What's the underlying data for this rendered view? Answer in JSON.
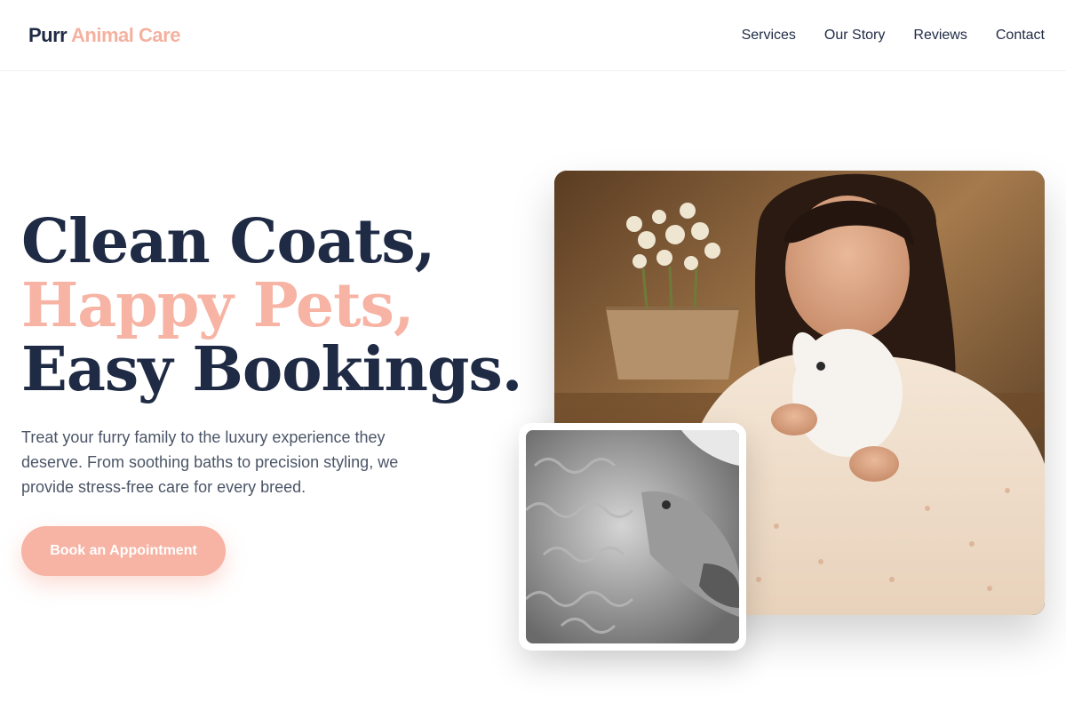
{
  "brand": {
    "name_dark": "Purr",
    "name_accent": "Animal Care"
  },
  "nav": {
    "items": [
      "Services",
      "Our Story",
      "Reviews",
      "Contact"
    ]
  },
  "hero": {
    "line1": "Clean Coats,",
    "line2": "Happy Pets,",
    "line3": "Easy Bookings.",
    "subtext": "Treat your furry family to the luxury experience they deserve. From soothing baths to precision styling, we provide stress-free care for every breed.",
    "cta_label": "Book an Appointment"
  },
  "colors": {
    "navy": "#1f2a44",
    "accent": "#f7b3a3",
    "body_text": "#4b5567"
  }
}
